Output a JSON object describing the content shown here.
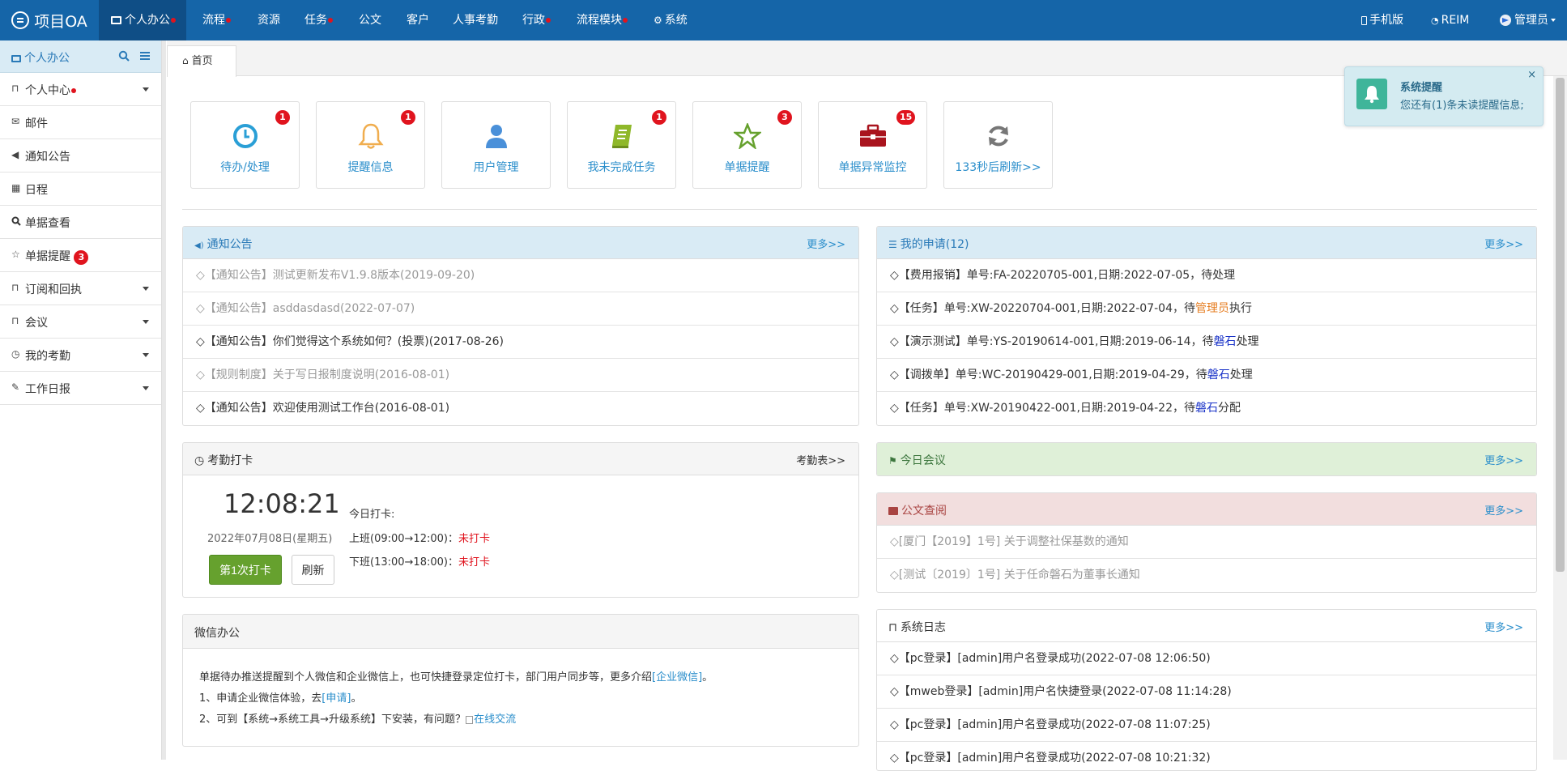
{
  "app": {
    "title": "项目OA"
  },
  "nav": {
    "items": [
      {
        "label": "个人办公",
        "dot": true
      },
      {
        "label": "流程",
        "dot": true
      },
      {
        "label": "资源",
        "dot": false
      },
      {
        "label": "任务",
        "dot": true
      },
      {
        "label": "公文",
        "dot": false
      },
      {
        "label": "客户",
        "dot": false
      },
      {
        "label": "人事考勤",
        "dot": false
      },
      {
        "label": "行政",
        "dot": true
      },
      {
        "label": "流程模块",
        "dot": true
      },
      {
        "label": "系统",
        "dot": false
      }
    ],
    "mobile": "手机版",
    "reim": "REIM",
    "user": "管理员"
  },
  "sidebar": {
    "title": "个人办公",
    "items": [
      {
        "label": "个人中心",
        "icon": "bookmark-icon",
        "caret": true,
        "dot": true
      },
      {
        "label": "邮件",
        "icon": "envelope-icon",
        "caret": false
      },
      {
        "label": "通知公告",
        "icon": "speaker-icon",
        "caret": false
      },
      {
        "label": "日程",
        "icon": "calendar-icon",
        "caret": false
      },
      {
        "label": "单据查看",
        "icon": "search-icon",
        "caret": false
      },
      {
        "label": "单据提醒",
        "icon": "star-icon",
        "caret": false,
        "badge": "3"
      },
      {
        "label": "订阅和回执",
        "icon": "bookmark-icon",
        "caret": true
      },
      {
        "label": "会议",
        "icon": "bookmark-icon",
        "caret": true
      },
      {
        "label": "我的考勤",
        "icon": "clock-icon",
        "caret": true
      },
      {
        "label": "工作日报",
        "icon": "edit-icon",
        "caret": true
      }
    ]
  },
  "tabs": {
    "home": "首页"
  },
  "tiles": [
    {
      "label": "待办/处理",
      "badge": "1",
      "icon": "clock-icon",
      "color": "#2a9fd6"
    },
    {
      "label": "提醒信息",
      "badge": "1",
      "icon": "bell-icon",
      "color": "#f0ad4e"
    },
    {
      "label": "用户管理",
      "badge": "",
      "icon": "user-icon",
      "color": "#4a90d9"
    },
    {
      "label": "我未完成任务",
      "badge": "1",
      "icon": "book-icon",
      "color": "#8fb82a"
    },
    {
      "label": "单据提醒",
      "badge": "3",
      "icon": "star-icon",
      "color": "#66a12e"
    },
    {
      "label": "单据异常监控",
      "badge": "15",
      "icon": "briefcase-icon",
      "color": "#a9141e"
    },
    {
      "label": "133秒后刷新>>",
      "badge": "",
      "icon": "refresh-icon",
      "color": "#777777"
    }
  ],
  "notice": {
    "title": "通知公告",
    "more": "更多>>",
    "items": [
      {
        "text": "【通知公告】测试更新发布V1.9.8版本(2019-09-20)",
        "read": true
      },
      {
        "text": "【通知公告】asddasdasd(2022-07-07)",
        "read": true
      },
      {
        "text": "【通知公告】你们觉得这个系统如何？(投票)(2017-08-26)",
        "read": false
      },
      {
        "text": "【规则制度】关于写日报制度说明(2016-08-01)",
        "read": true
      },
      {
        "text": "【通知公告】欢迎使用测试工作台(2016-08-01)",
        "read": false
      }
    ]
  },
  "myapply": {
    "title": "我的申请(12)",
    "more": "更多>>",
    "items": [
      {
        "pre": "【费用报销】单号:FA-20220705-001,日期:2022-07-05，待处理",
        "who": "",
        "post": ""
      },
      {
        "pre": "【任务】单号:XW-20220704-001,日期:2022-07-04，待",
        "who": "管理员",
        "post": "执行",
        "whoColor": "orange"
      },
      {
        "pre": "【演示测试】单号:YS-20190614-001,日期:2019-06-14，待",
        "who": "磐石",
        "post": "处理",
        "whoColor": "blue"
      },
      {
        "pre": "【调拨单】单号:WC-20190429-001,日期:2019-04-29，待",
        "who": "磐石",
        "post": "处理",
        "whoColor": "blue"
      },
      {
        "pre": "【任务】单号:XW-20190422-001,日期:2019-04-22，待",
        "who": "磐石",
        "post": "分配",
        "whoColor": "blue"
      }
    ]
  },
  "attendance": {
    "title": "考勤打卡",
    "link": "考勤表>>",
    "time": "12:08:21",
    "date": "2022年07月08日(星期五)",
    "punch_btn": "第1次打卡",
    "refresh_btn": "刷新",
    "today_label": "今日打卡:",
    "am_label": "上班(09:00→12:00)：",
    "am_status": "未打卡",
    "pm_label": "下班(13:00→18:00)：",
    "pm_status": "未打卡"
  },
  "meeting": {
    "title": "今日会议",
    "more": "更多>>"
  },
  "docs": {
    "title": "公文查阅",
    "more": "更多>>",
    "items": [
      "[厦门【2019】1号] 关于调整社保基数的通知",
      "[测试〔2019〕1号] 关于任命磐石为董事长通知"
    ]
  },
  "wechat": {
    "title": "微信办公",
    "line1_pre": "单据待办推送提醒到个人微信和企业微信上，也可快捷登录定位打卡，部门用户同步等，更多介绍",
    "line1_link": "[企业微信]",
    "line1_post": "。",
    "line2_pre": "1、申请企业微信体验，去",
    "line2_link": "[申请]",
    "line2_post": "。",
    "line3_pre": "2、可到【系统→系统工具→升级系统】下安装，有问题？",
    "line3_img": "在线交流"
  },
  "syslog": {
    "title": "系统日志",
    "more": "更多>>",
    "items": [
      "【pc登录】[admin]用户名登录成功(2022-07-08 12:06:50)",
      "【mweb登录】[admin]用户名快捷登录(2022-07-08 11:14:28)",
      "【pc登录】[admin]用户名登录成功(2022-07-08 11:07:25)",
      "【pc登录】[admin]用户名登录成功(2022-07-08 10:21:32)"
    ]
  },
  "toast": {
    "title": "系统提醒",
    "body": "您还有(1)条未读提醒信息;",
    "close": "×"
  }
}
